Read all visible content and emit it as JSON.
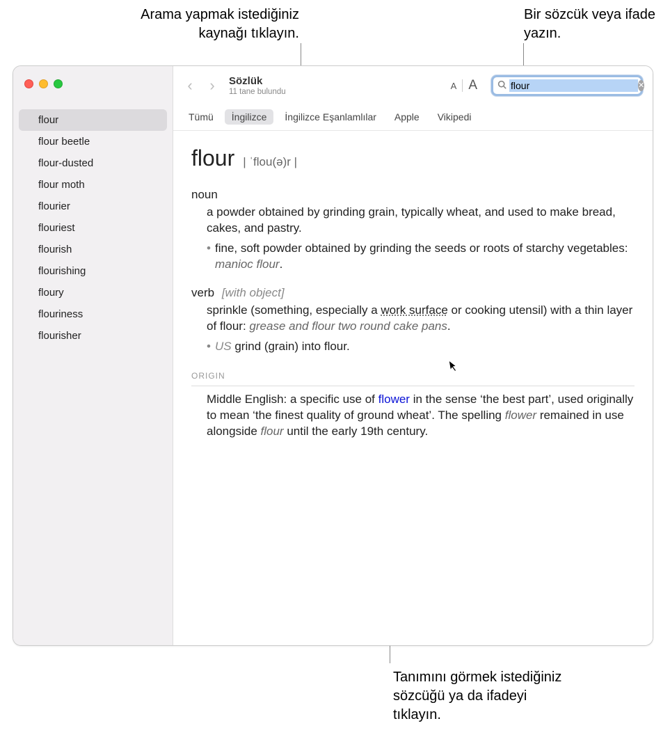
{
  "callouts": {
    "top_left": "Arama yapmak istediğiniz kaynağı tıklayın.",
    "top_right": "Bir sözcük veya ifade yazın.",
    "bottom": "Tanımını görmek istediğiniz sözcüğü ya da ifadeyi tıklayın."
  },
  "toolbar": {
    "title": "Sözlük",
    "subtitle": "11 tane bulundu"
  },
  "search": {
    "value": "flour"
  },
  "tabs": {
    "items": [
      {
        "label": "Tümü"
      },
      {
        "label": "İngilizce"
      },
      {
        "label": "İngilizce Eşanlamlılar"
      },
      {
        "label": "Apple"
      },
      {
        "label": "Vikipedi"
      }
    ],
    "selected_index": 1
  },
  "sidebar": {
    "items": [
      {
        "label": "flour"
      },
      {
        "label": "flour beetle"
      },
      {
        "label": "flour-dusted"
      },
      {
        "label": "flour moth"
      },
      {
        "label": "flourier"
      },
      {
        "label": "flouriest"
      },
      {
        "label": "flourish"
      },
      {
        "label": "flourishing"
      },
      {
        "label": "floury"
      },
      {
        "label": "flouriness"
      },
      {
        "label": "flourisher"
      }
    ],
    "selected_index": 0
  },
  "entry": {
    "headword": "flour",
    "pronunciation": "| ˈflou(ə)r |",
    "noun_label": "noun",
    "noun_def": "a powder obtained by grinding grain, typically wheat, and used to make bread, cakes, and pastry.",
    "noun_sub_pre": "fine, soft powder obtained by grinding the seeds or roots of starchy vegetables: ",
    "noun_sub_eg": "manioc flour",
    "noun_sub_post": ".",
    "verb_label": "verb",
    "verb_ann": "[with object]",
    "verb_def_pre": "sprinkle (something, especially a ",
    "verb_def_lookup": "work surface",
    "verb_def_mid": " or cooking utensil) with a thin layer of flour: ",
    "verb_def_eg": "grease and flour two round cake pans",
    "verb_def_post": ".",
    "verb_sub_region": "US",
    "verb_sub_text": " grind (grain) into flour.",
    "origin_label": "ORIGIN",
    "origin_pre": "Middle English: a specific use of ",
    "origin_link": "flower",
    "origin_mid": " in the sense ‘the best part’, used originally to mean ‘the finest quality of ground wheat’. The spelling ",
    "origin_em1": "flower",
    "origin_mid2": " remained in use alongside ",
    "origin_em2": "flour",
    "origin_post": " until the early 19th century."
  }
}
